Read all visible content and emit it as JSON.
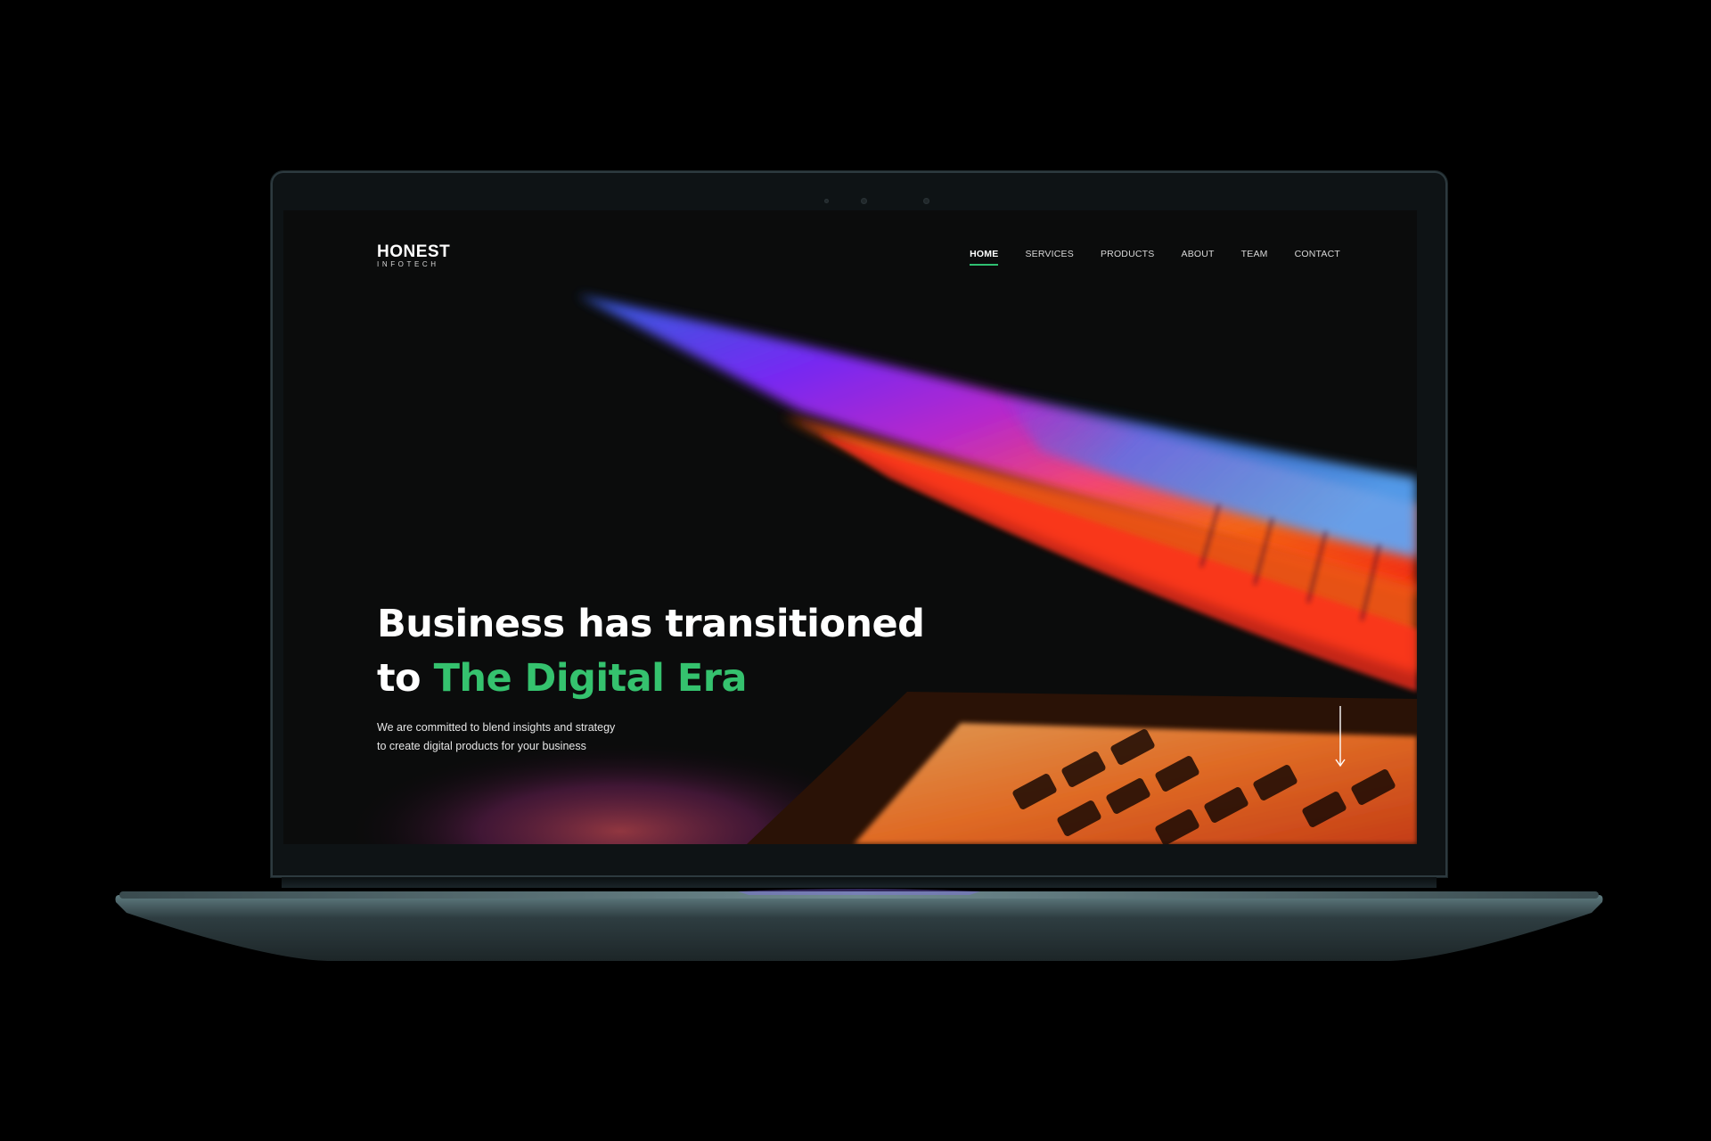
{
  "site": {
    "logo": {
      "name": "HONEST",
      "tagline": "INFOTECH"
    },
    "nav": [
      {
        "label": "HOME",
        "active": true
      },
      {
        "label": "SERVICES",
        "active": false
      },
      {
        "label": "PRODUCTS",
        "active": false
      },
      {
        "label": "ABOUT",
        "active": false
      },
      {
        "label": "TEAM",
        "active": false
      },
      {
        "label": "CONTACT",
        "active": false
      }
    ],
    "hero": {
      "title_line1": "Business has transitioned",
      "title_line2_prefix": "to ",
      "title_line2_accent": "The Digital Era",
      "subtitle_line1": "We are committed to blend insights and strategy",
      "subtitle_line2": "to create digital products for your business"
    }
  },
  "icons": {
    "scroll": "arrow-down-icon",
    "camera": "webcam-icon"
  },
  "colors": {
    "background": "#000000",
    "screen": "#0b0c0c",
    "accent_green": "#35c26e",
    "laptop_shell": "#2b3a3f"
  }
}
